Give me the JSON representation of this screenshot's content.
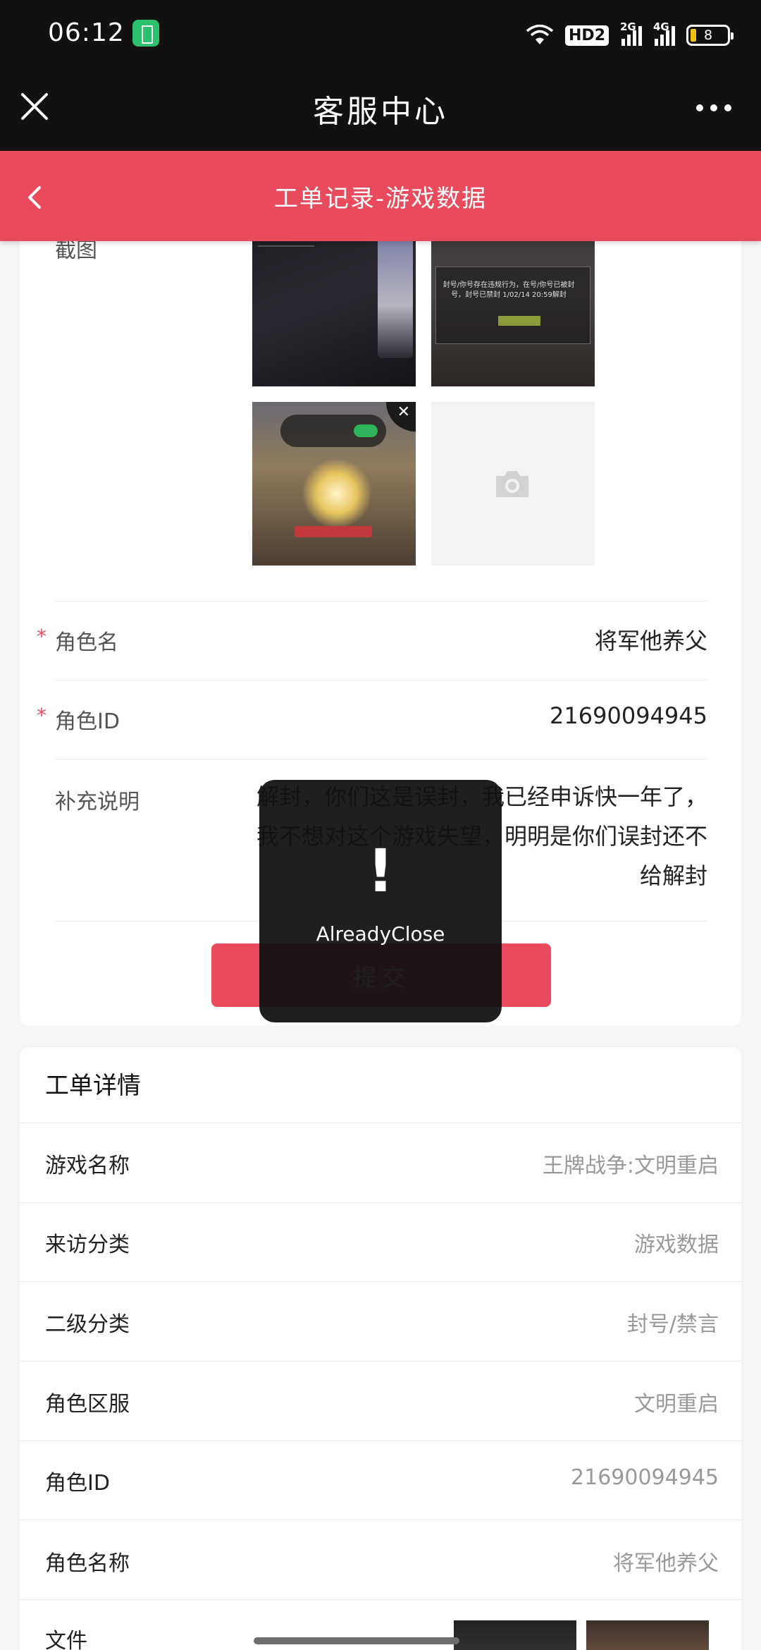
{
  "status_bar": {
    "time": "06:12",
    "hd_label": "HD2",
    "signal1_label": "2G",
    "signal2_label": "4G",
    "battery_level": "8"
  },
  "app_bar": {
    "title": "客服中心"
  },
  "page_header": {
    "title": "工单记录-游戏数据"
  },
  "form": {
    "screenshot_label": "截图",
    "thumbnail2_text": "封号/你号存在违规行为，在号/你号已被封号，封号已禁封 1/02/14 20:59解封",
    "rows": [
      {
        "label": "角色名",
        "value": "将军他养父",
        "required": true
      },
      {
        "label": "角色ID",
        "value": "21690094945",
        "required": true
      }
    ],
    "note_label": "补充说明",
    "note_value": "解封，你们这是误封，我已经申诉快一年了，我不想对这个游戏失望，明明是你们误封还不给解封",
    "submit_label": "提交"
  },
  "toast": {
    "icon": "!",
    "message": "AlreadyClose"
  },
  "details": {
    "title": "工单详情",
    "rows": [
      {
        "label": "游戏名称",
        "value": "王牌战争:文明重启"
      },
      {
        "label": "来访分类",
        "value": "游戏数据"
      },
      {
        "label": "二级分类",
        "value": "封号/禁言"
      },
      {
        "label": "角色区服",
        "value": "文明重启"
      },
      {
        "label": "角色ID",
        "value": "21690094945"
      },
      {
        "label": "角色名称",
        "value": "将军他养父"
      },
      {
        "label": "文件",
        "value": ""
      }
    ]
  },
  "colors": {
    "accent": "#e94a5c",
    "bar_bg": "#111111"
  }
}
